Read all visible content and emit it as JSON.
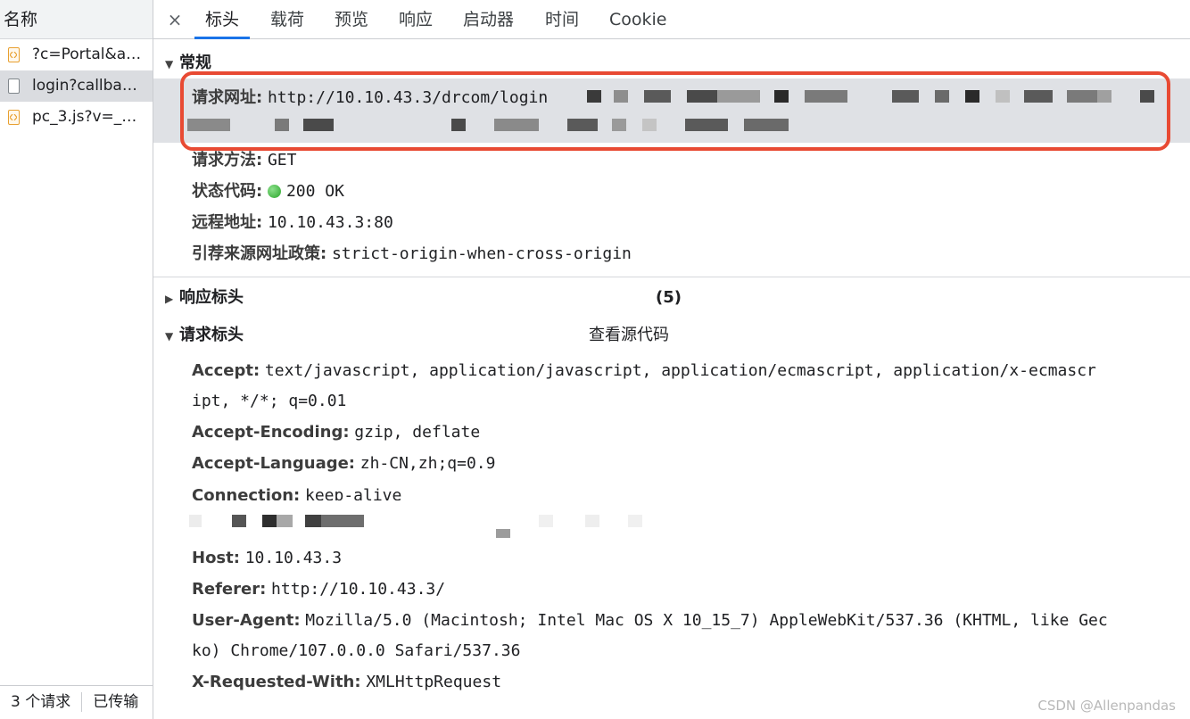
{
  "request_list": {
    "header": "名称",
    "items": [
      {
        "name": "?c=Portal&a…",
        "type": "script",
        "selected": false
      },
      {
        "name": "login?callba…",
        "type": "document",
        "selected": true
      },
      {
        "name": "pc_3.js?v=_…",
        "type": "script",
        "selected": false
      }
    ],
    "footer": {
      "request_count": "3 个请求",
      "transferred": "已传输"
    }
  },
  "tabs": {
    "close_glyph": "×",
    "items": [
      "标头",
      "载荷",
      "预览",
      "响应",
      "启动器",
      "时间",
      "Cookie"
    ],
    "active": "标头"
  },
  "general": {
    "title": "常规",
    "request_url_label": "请求网址:",
    "request_url_value": "http://10.10.43.3/drcom/login",
    "request_method_label": "请求方法:",
    "request_method_value": "GET",
    "status_code_label": "状态代码:",
    "status_code_value": "200 OK",
    "remote_address_label": "远程地址:",
    "remote_address_value": "10.10.43.3:80",
    "referrer_policy_label": "引荐来源网址政策:",
    "referrer_policy_value": "strict-origin-when-cross-origin"
  },
  "response_headers": {
    "title": "响应标头",
    "count": "(5)"
  },
  "request_headers": {
    "title": "请求标头",
    "view_source": "查看源代码",
    "accept_label": "Accept:",
    "accept_value_line1": "text/javascript, application/javascript, application/ecmascript, application/x-ecmascr",
    "accept_value_line2": "ipt, */*; q=0.01",
    "accept_encoding_label": "Accept-Encoding:",
    "accept_encoding_value": "gzip, deflate",
    "accept_language_label": "Accept-Language:",
    "accept_language_value": "zh-CN,zh;q=0.9",
    "connection_label": "Connection:",
    "connection_value": "keep-alive",
    "host_label": "Host:",
    "host_value": "10.10.43.3",
    "referer_label": "Referer:",
    "referer_value": "http://10.10.43.3/",
    "user_agent_label": "User-Agent:",
    "user_agent_value_line1": "Mozilla/5.0 (Macintosh; Intel Mac OS X 10_15_7) AppleWebKit/537.36 (KHTML, like Gec",
    "user_agent_value_line2": "ko) Chrome/107.0.0.0 Safari/537.36",
    "x_requested_with_label": "X-Requested-With:",
    "x_requested_with_value": "XMLHttpRequest"
  },
  "watermark": "CSDN @Allenpandas",
  "colors": {
    "active_tab_underline": "#1a73e8",
    "highlight_box": "#e84a33",
    "status_ok": "#2aa52a"
  }
}
